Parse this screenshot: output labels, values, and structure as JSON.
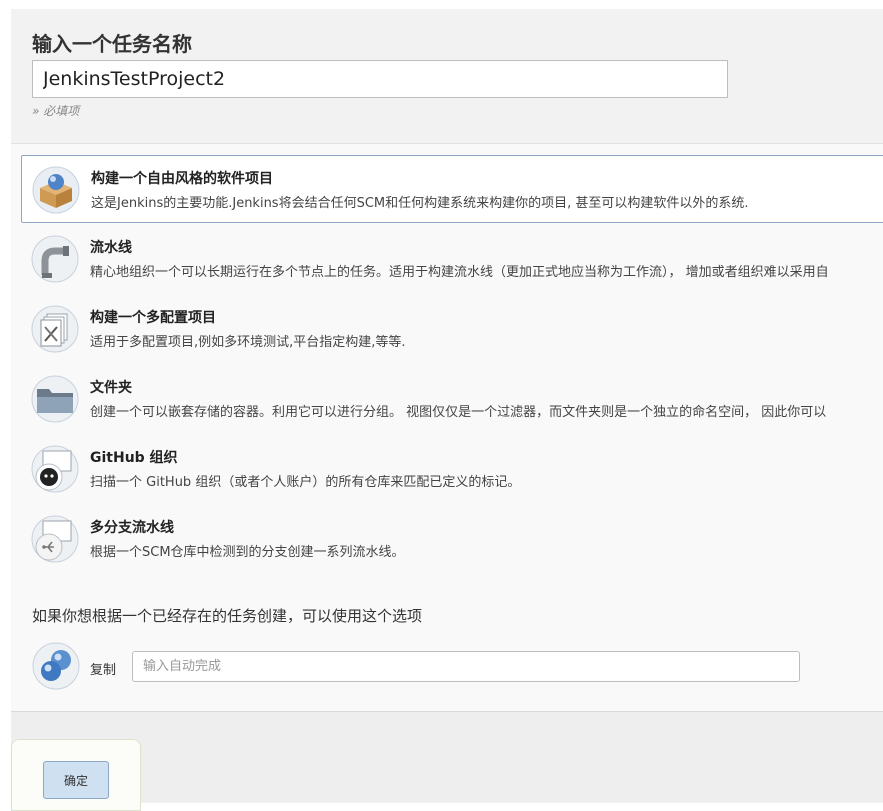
{
  "header": {
    "title": "输入一个任务名称",
    "item_name_value": "JenkinsTestProject2",
    "required_note": "» 必填项"
  },
  "types": [
    {
      "title": "构建一个自由风格的软件项目",
      "description": "这是Jenkins的主要功能.Jenkins将会结合任何SCM和任何构建系统来构建你的项目, 甚至可以构建软件以外的系统.",
      "icon": "freestyle-box-icon",
      "selected": true
    },
    {
      "title": "流水线",
      "description": "精心地组织一个可以长期运行在多个节点上的任务。适用于构建流水线（更加正式地应当称为工作流）， 增加或者组织难以采用自",
      "icon": "pipeline-icon",
      "selected": false
    },
    {
      "title": "构建一个多配置项目",
      "description": "适用于多配置项目,例如多环境测试,平台指定构建,等等.",
      "icon": "multi-config-icon",
      "selected": false
    },
    {
      "title": "文件夹",
      "description": "创建一个可以嵌套存储的容器。利用它可以进行分组。 视图仅仅是一个过滤器，而文件夹则是一个独立的命名空间， 因此你可以",
      "icon": "folder-icon",
      "selected": false
    },
    {
      "title": "GitHub 组织",
      "description": "扫描一个 GitHub 组织（或者个人账户）的所有仓库来匹配已定义的标记。",
      "icon": "github-org-icon",
      "selected": false
    },
    {
      "title": "多分支流水线",
      "description": "根据一个SCM仓库中检测到的分支创建一系列流水线。",
      "icon": "multibranch-pipeline-icon",
      "selected": false
    }
  ],
  "copy": {
    "heading": "如果你想根据一个已经存在的任务创建，可以使用这个选项",
    "label": "复制",
    "placeholder": "输入自动完成",
    "icon": "copy-spheres-icon"
  },
  "actions": {
    "ok_label": "确定"
  },
  "colors": {
    "selected_border": "#8fa6c5",
    "ok_button_bg": "#cfe0f0",
    "page_bg": "#f2f2f2"
  }
}
